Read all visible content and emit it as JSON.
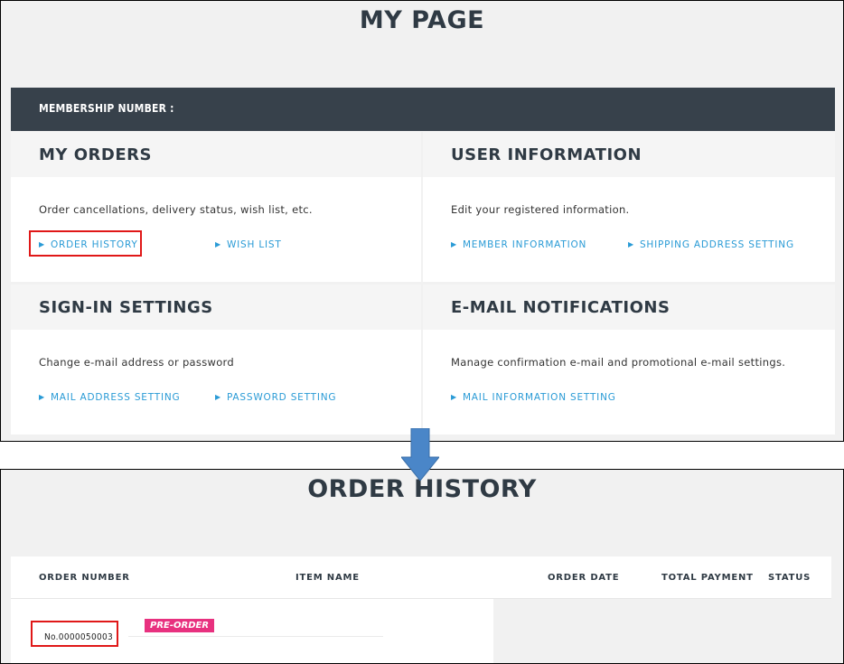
{
  "my_page": {
    "title": "MY PAGE",
    "membership_label": "MEMBERSHIP NUMBER :",
    "panels": [
      {
        "title": "MY ORDERS",
        "description": "Order cancellations, delivery status, wish list, etc.",
        "links": [
          "ORDER HISTORY",
          "WISH LIST"
        ]
      },
      {
        "title": "USER INFORMATION",
        "description": "Edit your registered information.",
        "links": [
          "MEMBER INFORMATION",
          "SHIPPING ADDRESS SETTING"
        ]
      },
      {
        "title": "SIGN-IN SETTINGS",
        "description": "Change e-mail address or password",
        "links": [
          "MAIL ADDRESS SETTING",
          "PASSWORD SETTING"
        ]
      },
      {
        "title": "E-MAIL NOTIFICATIONS",
        "description": "Manage confirmation e-mail and promotional e-mail settings.",
        "links": [
          "MAIL INFORMATION SETTING"
        ]
      }
    ]
  },
  "order_history": {
    "title": "ORDER HISTORY",
    "columns": [
      "ORDER NUMBER",
      "ITEM NAME",
      "ORDER DATE",
      "TOTAL PAYMENT",
      "STATUS"
    ],
    "rows": [
      {
        "order_number": "No.0000050003",
        "badge": "PRE-ORDER"
      }
    ]
  },
  "colors": {
    "header_bar": "#37414b",
    "link": "#2a9bd6",
    "highlight": "#e01818",
    "badge": "#e8317f",
    "arrow": "#4a86c8"
  },
  "icons": {
    "link_marker": "▶",
    "transition_arrow": "down-arrow-icon"
  }
}
